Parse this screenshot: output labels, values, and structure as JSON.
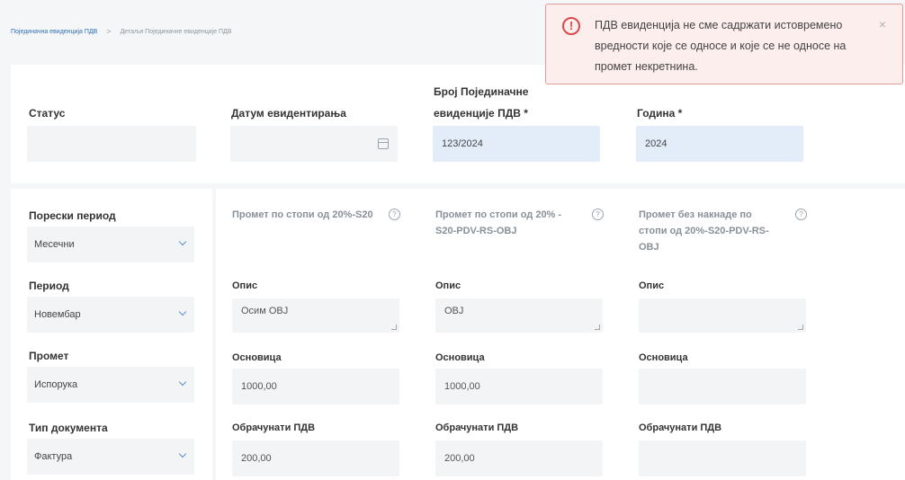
{
  "breadcrumb": {
    "link": "Појединачна евиденција ПДВ",
    "separator": ">",
    "current": "Детаљи Појединачне евиденције ПДВ"
  },
  "header": {
    "status": {
      "label": "Статус",
      "value": ""
    },
    "date": {
      "label": "Датум евидентирања",
      "value": "",
      "icon": "calendar-icon"
    },
    "number": {
      "label_line1": "Број Појединачне",
      "label_line2": "евиденције ПДВ *",
      "value": "123/2024"
    },
    "year": {
      "label": "Година *",
      "value": "2024"
    }
  },
  "left": {
    "tax_period": {
      "label": "Порески период",
      "value": "Месечни"
    },
    "period": {
      "label": "Период",
      "value": "Новембар"
    },
    "turnover": {
      "label": "Промет",
      "value": "Испорука"
    },
    "doc_type": {
      "label": "Тип документа",
      "value": "Фактура"
    }
  },
  "columns": [
    {
      "title": "Промет по стопи од 20%-S20",
      "desc_label": "Опис",
      "desc_value": "Осим ОВЈ",
      "base_label": "Основица",
      "base_value": "1000,00",
      "vat_label": "Обрачунати ПДВ",
      "vat_value": "200,00"
    },
    {
      "title": "Промет по стопи од 20% - S20-PDV-RS-OBJ",
      "desc_label": "Опис",
      "desc_value": "ОВЈ",
      "base_label": "Основица",
      "base_value": "1000,00",
      "vat_label": "Обрачунати ПДВ",
      "vat_value": "200,00"
    },
    {
      "title": "Промет без накнаде по стопи од 20%-S20-PDV-RS-OBJ",
      "desc_label": "Опис",
      "desc_value": "",
      "base_label": "Основица",
      "base_value": "",
      "vat_label": "Обрачунати ПДВ",
      "vat_value": ""
    }
  ],
  "toast": {
    "icon": "error-icon",
    "message": "ПДВ евиденција не сме садржати истовремено вредности које се односе и које се не односе на промет некретнина.",
    "close": "×"
  },
  "colors": {
    "accent": "#2f6fb6",
    "error": "#d8494a",
    "required_bg": "#e3edf9"
  }
}
